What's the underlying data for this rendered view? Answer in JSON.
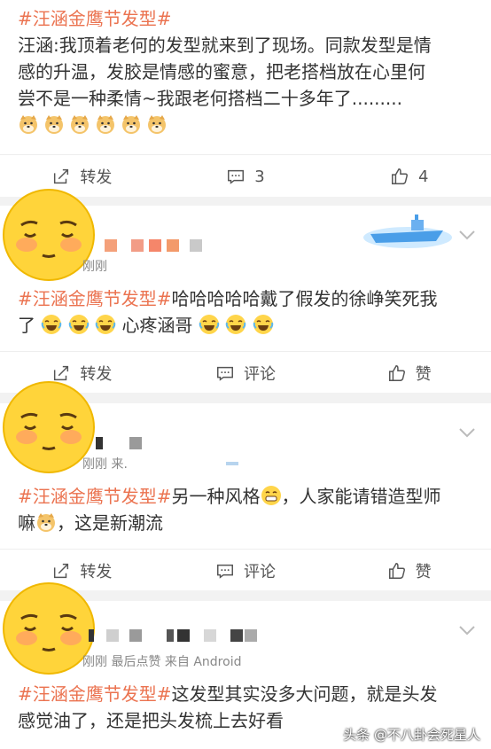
{
  "post1": {
    "topic": "#汪涵金鹰节发型#",
    "line1": "汪涵:我顶着老何的发型就来到了现场。同款发型是情",
    "line2": "感的升温，发胶是情感的蜜意，把老搭档放在心里何",
    "line3": "尝不是一种柔情~我跟老何搭档二十多年了.........",
    "repost_label": "转发",
    "comment_count": "3",
    "like_count": "4"
  },
  "comment1": {
    "time": "刚刚",
    "topic": "#汪涵金鹰节发型#",
    "text1": "哈哈哈哈哈戴了假发的徐峥笑死我",
    "text2_prefix": "了",
    "text2_suffix": "心疼涵哥",
    "repost_label": "转发",
    "comment_label": "评论",
    "like_label": "赞"
  },
  "comment2": {
    "time": "刚刚  来.",
    "topic": "#汪涵金鹰节发型#",
    "text1": "另一种风格",
    "text1_suffix": "，人家能请错造型师",
    "text2_prefix": "嘛",
    "text2_suffix": "，这是新潮流",
    "repost_label": "转发",
    "comment_label": "评论",
    "like_label": "赞"
  },
  "comment3": {
    "time": "刚刚  最后点赞  来自 Android",
    "topic": "#汪涵金鹰节发型#",
    "text1": "这发型其实没多大问题，就是头发",
    "text2": "感觉油了，还是把头发梳上去好看"
  },
  "watermark": "头条 @不八卦会死星人",
  "colors": {
    "topic": "#eb7350",
    "background": "#f2f2f2"
  }
}
